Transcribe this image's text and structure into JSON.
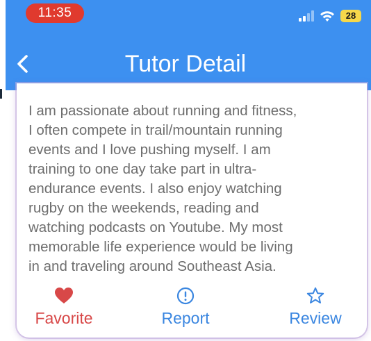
{
  "status_bar": {
    "time": "11:35",
    "battery": "28",
    "signal_icon": "cellular-signal-icon",
    "wifi_icon": "wifi-icon"
  },
  "header": {
    "title": "Tutor Detail",
    "back_icon": "chevron-left-icon"
  },
  "tutor": {
    "bio": "I am passionate about running and fitness,\nI often compete in trail/mountain running\nevents and I love pushing myself. I am\ntraining to one day take part in ultra-\nendurance events. I also enjoy watching\nrugby on the weekends, reading and\nwatching podcasts on Youtube. My most\nmemorable life experience would be living\nin and traveling around Southeast Asia."
  },
  "actions": {
    "favorite": {
      "label": "Favorite",
      "icon": "heart-icon",
      "color": "#d84848"
    },
    "report": {
      "label": "Report",
      "icon": "exclamation-circle-icon",
      "color": "#3a86e0"
    },
    "review": {
      "label": "Review",
      "icon": "star-outline-icon",
      "color": "#3a86e0"
    }
  },
  "colors": {
    "header_background": "#3d90f0",
    "time_pill": "#e03a2e",
    "battery_fill": "#f6d84a",
    "bio_text": "#6e6e6e"
  }
}
